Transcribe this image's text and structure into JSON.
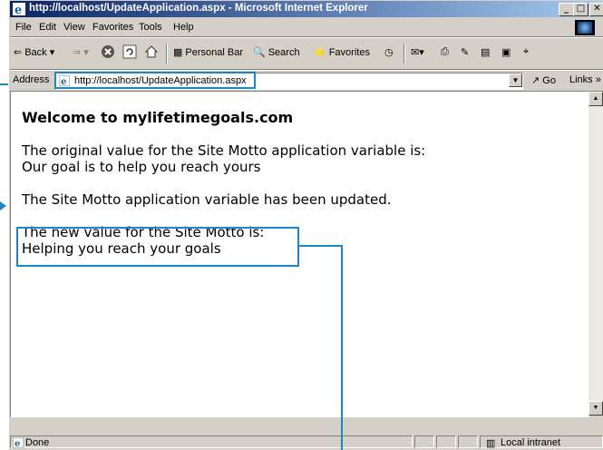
{
  "window": {
    "title": "http://localhost/UpdateApplication.aspx - Microsoft Internet Explorer",
    "controls": {
      "minimize": "_",
      "maximize": "□",
      "close": "✕"
    }
  },
  "menu": [
    "File",
    "Edit",
    "View",
    "Favorites",
    "Tools",
    "Help"
  ],
  "toolbar": {
    "back": "Back",
    "personal_bar": "Personal Bar",
    "search": "Search",
    "favorites": "Favorites"
  },
  "address": {
    "label": "Address",
    "url": "http://localhost/UpdateApplication.aspx",
    "go": "Go",
    "links": "Links"
  },
  "page": {
    "heading": "Welcome to mylifetimegoals.com",
    "original_label": "The original value for the Site Motto application variable is:",
    "original_value": "Our goal is to help you reach yours",
    "updated_message": "The Site Motto application variable has been updated.",
    "new_label": "The new value for the Site Motto is:",
    "new_value": "Helping you reach your goals"
  },
  "status": {
    "text": "Done",
    "zone": "Local intranet"
  },
  "colors": {
    "callout": "#1b87c9",
    "titlebar_start": "#0a246a",
    "titlebar_end": "#a6caf0",
    "chrome": "#d4d0c8"
  }
}
